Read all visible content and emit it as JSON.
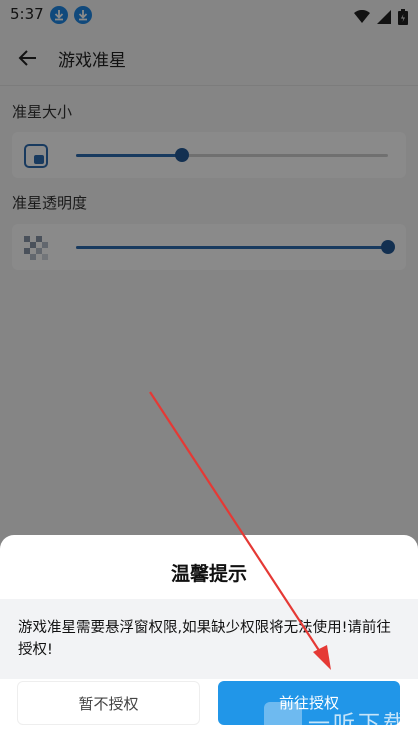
{
  "status_bar": {
    "time": "5:37",
    "icons": [
      "download-icon",
      "download-icon",
      "wifi-icon",
      "cell-signal-icon",
      "battery-icon"
    ]
  },
  "app_bar": {
    "title": "游戏准星"
  },
  "settings": {
    "size_label": "准星大小",
    "size_value": 0.34,
    "opacity_label": "准星透明度",
    "opacity_value": 1.0
  },
  "dialog": {
    "title": "温馨提示",
    "body": "游戏准星需要悬浮窗权限,如果缺少权限将无法使用!请前往授权!",
    "cancel_label": "暂不授权",
    "confirm_label": "前往授权"
  },
  "colors": {
    "accent": "#2196e8",
    "slider": "#2e6bb0",
    "annotation_arrow": "#e53935"
  },
  "watermark": {
    "text": "一听下载"
  }
}
